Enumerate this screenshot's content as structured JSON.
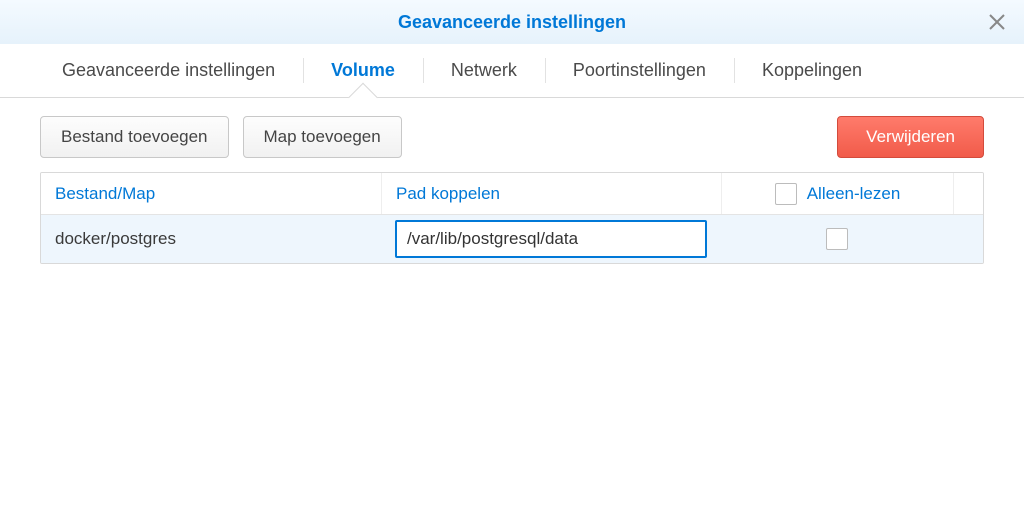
{
  "header": {
    "title": "Geavanceerde instellingen"
  },
  "tabs": [
    {
      "label": "Geavanceerde instellingen",
      "active": false
    },
    {
      "label": "Volume",
      "active": true
    },
    {
      "label": "Netwerk",
      "active": false
    },
    {
      "label": "Poortinstellingen",
      "active": false
    },
    {
      "label": "Koppelingen",
      "active": false
    }
  ],
  "toolbar": {
    "add_file": "Bestand toevoegen",
    "add_folder": "Map toevoegen",
    "delete": "Verwijderen"
  },
  "table": {
    "headers": {
      "filemap": "Bestand/Map",
      "mountpath": "Pad koppelen",
      "readonly": "Alleen-lezen"
    },
    "rows": [
      {
        "filemap": "docker/postgres",
        "mountpath": "/var/lib/postgresql/data",
        "readonly": false
      }
    ]
  }
}
